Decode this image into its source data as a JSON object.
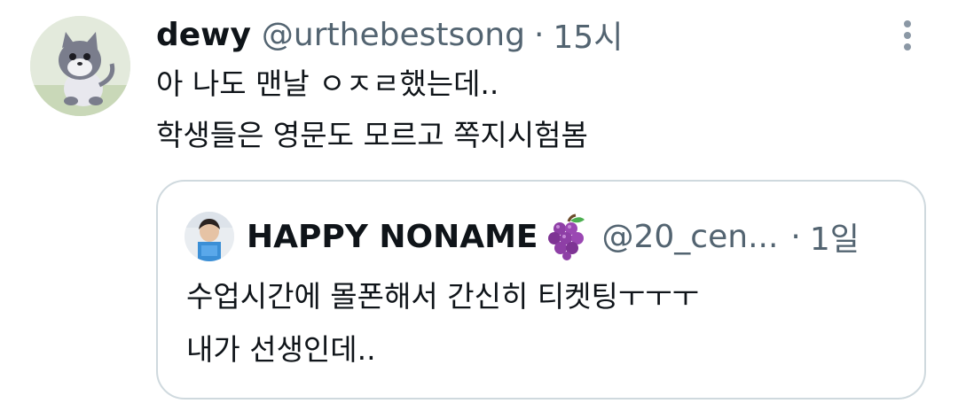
{
  "tweet": {
    "author": {
      "display_name": "dewy",
      "handle": "@urthebestsong",
      "avatar_icon": "cartoon-cat-avatar"
    },
    "separator": "·",
    "time": "15시",
    "more_icon": "more-vertical-icon",
    "text_lines": [
      "아 나도 맨날 ㅇㅈㄹ했는데..",
      "학생들은 영문도 모르고 쪽지시험봄"
    ],
    "quoted_tweet": {
      "author": {
        "display_name": "HAPPY NONAME",
        "emoji": "grapes-emoji",
        "handle": "@20_cen...",
        "avatar_icon": "person-avatar"
      },
      "separator": "·",
      "time": "1일",
      "text_lines": [
        "수업시간에 몰폰해서 간신히 티켓팅ㅜㅜㅜ",
        "내가 선생인데.."
      ]
    }
  },
  "colors": {
    "text_primary": "#0f1419",
    "text_secondary": "#536471",
    "border": "#cfd9de",
    "grape_purple": "#8e3fa6"
  }
}
